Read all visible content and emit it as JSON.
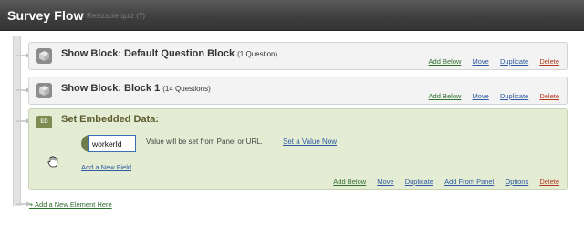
{
  "header": {
    "title": "Survey Flow",
    "subtitle": "Resizable quiz (?)"
  },
  "blocks": [
    {
      "title": "Show Block: Default Question Block",
      "count": "(1 Question)",
      "actions": [
        "Add Below",
        "Move",
        "Duplicate",
        "Delete"
      ]
    },
    {
      "title": "Show Block: Block 1",
      "count": "(14 Questions)",
      "actions": [
        "Add Below",
        "Move",
        "Duplicate",
        "Delete"
      ]
    }
  ],
  "embedded": {
    "icon_text": "ED",
    "title": "Set Embedded Data:",
    "field_value": "workerId",
    "value_note": "Value will be set from Panel or URL.",
    "set_value_link": "Set a Value Now",
    "add_field_link": "Add a New Field",
    "actions": [
      "Add Below",
      "Move",
      "Duplicate",
      "Add From Panel",
      "Options",
      "Delete"
    ]
  },
  "add_element_link": "+ Add a New Element Here",
  "icons": {
    "block": "cube-icon",
    "embedded": "embedded-data-icon",
    "cursor": "hand-cursor-icon"
  },
  "colors": {
    "header": "#3e3e3e",
    "block_bg": "#f3f3f3",
    "embedded_bg": "#e5ecd4",
    "link_green": "#2f6f2f",
    "link_blue": "#2c5aa0",
    "link_red": "#b33a1f"
  }
}
